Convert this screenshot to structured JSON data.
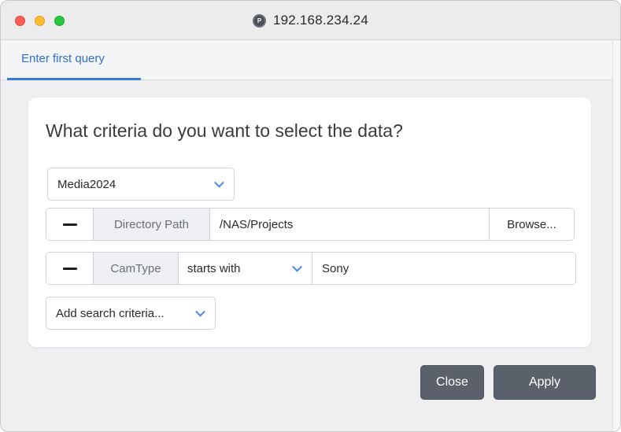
{
  "window": {
    "title": "192.168.234.24",
    "site_icon": "P"
  },
  "tabs": [
    {
      "label": "Enter first query",
      "active": true
    }
  ],
  "form": {
    "question": "What criteria do you want to select the data?",
    "database_select": {
      "value": "Media2024"
    },
    "criteria": [
      {
        "label": "Directory Path",
        "value": "/NAS/Projects",
        "browse_label": "Browse..."
      },
      {
        "label": "CamType",
        "operator": "starts with",
        "value": "Sony"
      }
    ],
    "add_criteria_select": {
      "value": "Add search criteria..."
    }
  },
  "footer": {
    "close_label": "Close",
    "apply_label": "Apply"
  },
  "colors": {
    "accent": "#3a77d6",
    "button": "#5a616b",
    "chevron": "#4a8ee8"
  }
}
